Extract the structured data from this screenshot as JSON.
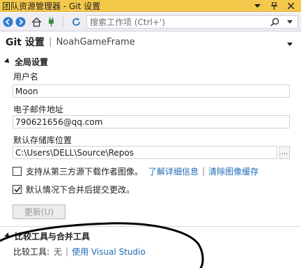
{
  "titlebar": {
    "title": "团队资源管理器 - Git 设置",
    "pin_icon": "pin-icon",
    "close_icon": "close-icon",
    "menu_icon": "chevron-down-icon"
  },
  "toolbar": {
    "search_placeholder": "搜索工作项 (Ctrl+')"
  },
  "header": {
    "title": "Git 设置",
    "separator": "|",
    "repo": "NoahGameFrame"
  },
  "global": {
    "section_title": "全局设置",
    "username_label": "用户名",
    "username_value": "Moon",
    "email_label": "电子邮件地址",
    "email_value": "790621656@qq.com",
    "repo_location_label": "默认存储库位置",
    "repo_location_value": "C:\\Users\\DELL\\Source\\Repos",
    "browse_label": "...",
    "avatar_option_label": "支持从第三方源下载作者图像。",
    "avatar_option_checked": false,
    "learn_more_link": "了解详细信息",
    "link_separator": "|",
    "clear_cache_link": "清除图像缓存",
    "merge_commit_label": "默认情况下合并后提交更改。",
    "merge_commit_checked": true,
    "update_button": "更新(U)"
  },
  "diff": {
    "section_title": "比较工具与合并工具",
    "compare_label": "比较工具:",
    "compare_value": "无",
    "separator": "|",
    "use_vs_link": "使用 Visual Studio"
  },
  "colors": {
    "titlebar_bg": "#f4c84a",
    "link": "#1e6ab4",
    "annotation_stroke": "#000000"
  }
}
